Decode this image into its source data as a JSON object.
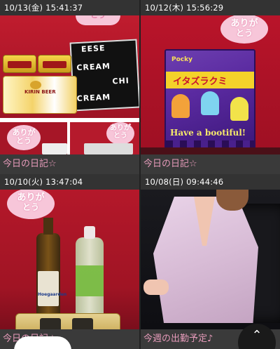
{
  "cards": [
    {
      "time": "10/13(金) 15:41:37",
      "caption": "今日の日記☆",
      "sticker_line1": "ありが",
      "sticker_line2": "とう",
      "sticker2_line1": "ありが",
      "sticker2_line2": "とう",
      "sticker3_line1": "ありが",
      "sticker3_line2": "とう",
      "box_text": [
        "EESE",
        "CREAM",
        "CHI",
        "CREAM"
      ]
    },
    {
      "time": "10/12(木) 15:56:29",
      "caption": "今日の日記☆",
      "sticker_line1": "ありが",
      "sticker_line2": "とう",
      "bag_top": "Pocky",
      "bag_title": "イタズラクミ",
      "bag_boo": "Have a bootiful!"
    },
    {
      "time": "10/10(火) 13:47:04",
      "caption": "今日の日記☆",
      "sticker_line1": "ありが",
      "sticker_line2": "とう"
    },
    {
      "time": "10/08(日) 09:44:46",
      "caption": "今週の出勤予定♪"
    }
  ],
  "scroll_top_icon": "chevron-up-icon",
  "colors": {
    "caption": "#e59ab9",
    "sticker": "#f7c6d9",
    "header": "#333333"
  }
}
